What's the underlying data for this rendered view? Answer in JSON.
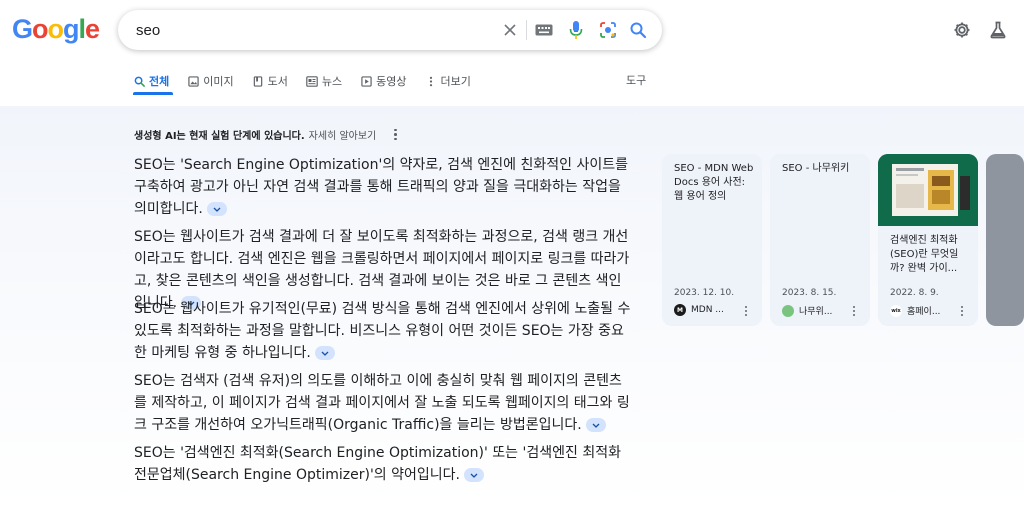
{
  "header": {
    "logo_letters": [
      {
        "ch": "G",
        "color": "#4285F4"
      },
      {
        "ch": "o",
        "color": "#EA4335"
      },
      {
        "ch": "o",
        "color": "#FBBC05"
      },
      {
        "ch": "g",
        "color": "#4285F4"
      },
      {
        "ch": "l",
        "color": "#34A853"
      },
      {
        "ch": "e",
        "color": "#EA4335"
      }
    ],
    "search_value": "seo",
    "icons": [
      "clear-icon",
      "keyboard-icon",
      "microphone-icon",
      "camera-lens-icon",
      "search-icon"
    ],
    "right_icons": [
      "settings-gear-icon",
      "labs-flask-icon"
    ]
  },
  "tabs": [
    {
      "label": "전체",
      "icon": "search-icon",
      "active": true
    },
    {
      "label": "이미지",
      "icon": "image-icon",
      "active": false
    },
    {
      "label": "도서",
      "icon": "book-icon",
      "active": false
    },
    {
      "label": "뉴스",
      "icon": "news-icon",
      "active": false
    },
    {
      "label": "동영상",
      "icon": "video-icon",
      "active": false
    },
    {
      "label": "더보기",
      "icon": "more-vert-icon",
      "active": false
    }
  ],
  "tools_label": "도구",
  "sge": {
    "notice_bold": "생성형 AI는 현재 실험 단계에 있습니다.",
    "notice_link": "자세히 알아보기",
    "paragraphs": [
      "SEO는 'Search Engine Optimization'의 약자로, 검색 엔진에 친화적인 사이트를 구축하여 광고가 아닌 자연 검색 결과를 통해 트래픽의 양과 질을 극대화하는 작업을 의미합니다.",
      "SEO는 웹사이트가 검색 결과에 더 잘 보이도록 최적화하는 과정으로, 검색 랭크 개선이라고도 합니다. 검색 엔진은 웹을 크롤링하면서 페이지에서 페이지로 링크를 따라가고, 찾은 콘텐츠의 색인을 생성합니다. 검색 결과에 보이는 것은 바로 그 콘텐츠 색인입니다.",
      "SEO는 웹사이트가 유기적인(무료) 검색 방식을 통해 검색 엔진에서 상위에 노출될 수 있도록 최적화하는 과정을 말합니다. 비즈니스 유형이 어떤 것이든 SEO는 가장 중요한 마케팅 유형 중 하나입니다.",
      "SEO는 검색자 (검색 유저)의 의도를 이해하고 이에 충실히 맞춰 웹 페이지의 콘텐츠를 제작하고, 이 페이지가 검색 결과 페이지에서 잘 노출 되도록 웹페이지의 태그와 링크 구조를 개선하여 오가닉트래픽(Organic Traffic)을 늘리는 방법론입니다.",
      "SEO는 '검색엔진 최적화(Search Engine Optimization)' 또는 '검색엔진 최적화 전문업체(Search Engine Optimizer)'의 약어입니다."
    ]
  },
  "cards": [
    {
      "title": "SEO - MDN Web Docs 용어 사전: 웹 용어 정의",
      "date": "2023. 12. 10.",
      "source": "MDN ...",
      "fav_text": "M",
      "fav_color": "#1b1b1b",
      "has_image": false
    },
    {
      "title": "SEO - 나무위키",
      "date": "2023. 8. 15.",
      "source": "나무위...",
      "fav_text": "",
      "fav_color": "#7bc47f",
      "has_image": false
    },
    {
      "title": "검색엔진 최적화(SEO)란 무엇일까? 완벽 가이...",
      "date": "2022. 8. 9.",
      "source": "홈페이...",
      "fav_text": "wix",
      "fav_color": "#ffffff",
      "has_image": true
    }
  ]
}
